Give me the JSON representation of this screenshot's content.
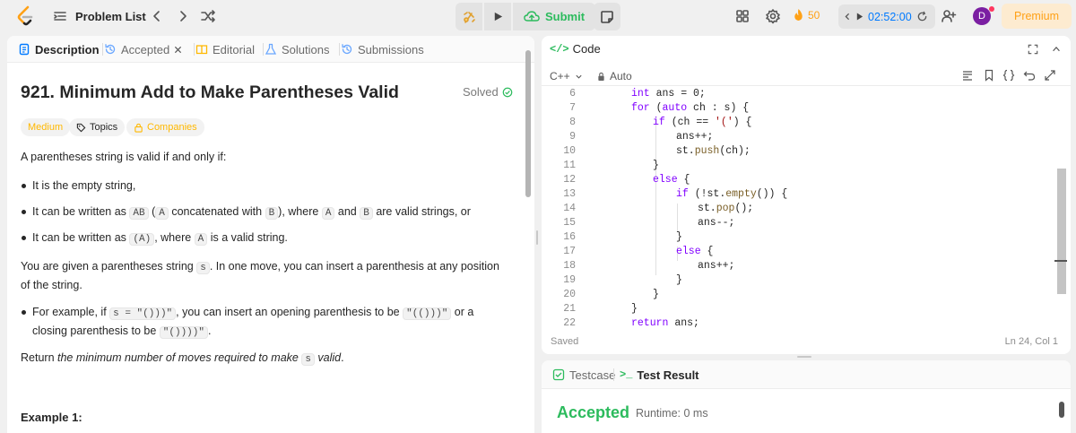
{
  "topbar": {
    "problem_list": "Problem List",
    "submit": "Submit",
    "streak": "50",
    "timer": "02:52:00",
    "avatar_letter": "D",
    "premium": "Premium"
  },
  "left_tabs": [
    {
      "label": "Description"
    },
    {
      "label": "Accepted"
    },
    {
      "label": "Editorial"
    },
    {
      "label": "Solutions"
    },
    {
      "label": "Submissions"
    }
  ],
  "problem": {
    "title": "921. Minimum Add to Make Parentheses Valid",
    "solved": "Solved",
    "difficulty": "Medium",
    "topics": "Topics",
    "companies": "Companies",
    "intro": "A parentheses string is valid if and only if:",
    "bullet1": "It is the empty string,",
    "bullet2": {
      "t1": "It can be written as ",
      "c1": "AB",
      "t2": " (",
      "c2": "A",
      "t3": " concatenated with ",
      "c3": "B",
      "t4": "), where ",
      "c4": "A",
      "t5": " and ",
      "c5": "B",
      "t6": " are valid strings, or"
    },
    "bullet3": {
      "t1": "It can be written as ",
      "c1": "(A)",
      "t2": ", where ",
      "c2": "A",
      "t3": " is a valid string."
    },
    "para2": {
      "t1": "You are given a parentheses string ",
      "c1": "s",
      "t2": ". In one move, you can insert a parenthesis at any position of the string."
    },
    "example_bullet": {
      "t1": "For example, if ",
      "c1": "s = \"()))\"",
      "t2": ", you can insert an opening parenthesis to be ",
      "c2": "\"(()))\"",
      "t3": " or a closing parenthesis to be ",
      "c3": "\"())))\"",
      "t4": "."
    },
    "return": {
      "t1": "Return ",
      "i1": "the minimum number of moves required to make ",
      "c1": "s",
      "i2": " valid",
      "t2": "."
    },
    "example_heading": "Example 1:"
  },
  "code_panel": {
    "title": "Code",
    "language": "C++",
    "mode": "Auto",
    "status": "Saved",
    "cursor": "Ln 24, Col 1"
  },
  "code_lines": [
    {
      "n": "6",
      "code": "int ans = 0;"
    },
    {
      "n": "7",
      "code": "for (auto ch : s) {"
    },
    {
      "n": "8",
      "code": "if (ch == '(') {"
    },
    {
      "n": "9",
      "code": "ans++;"
    },
    {
      "n": "10",
      "code": "st.push(ch);"
    },
    {
      "n": "11",
      "code": "}"
    },
    {
      "n": "12",
      "code": "else {"
    },
    {
      "n": "13",
      "code": "if (!st.empty()) {"
    },
    {
      "n": "14",
      "code": "st.pop();"
    },
    {
      "n": "15",
      "code": "ans--;"
    },
    {
      "n": "16",
      "code": "}"
    },
    {
      "n": "17",
      "code": "else {"
    },
    {
      "n": "18",
      "code": "ans++;"
    },
    {
      "n": "19",
      "code": "}"
    },
    {
      "n": "20",
      "code": "}"
    },
    {
      "n": "21",
      "code": "}"
    },
    {
      "n": "22",
      "code": "return ans;"
    }
  ],
  "result_panel": {
    "tab_testcase": "Testcase",
    "tab_result": "Test Result",
    "status": "Accepted",
    "runtime": "Runtime: 0 ms"
  },
  "colors": {
    "accent_green": "#2cbb5d",
    "accent_orange": "#ffa116",
    "accent_blue": "#007aff"
  }
}
